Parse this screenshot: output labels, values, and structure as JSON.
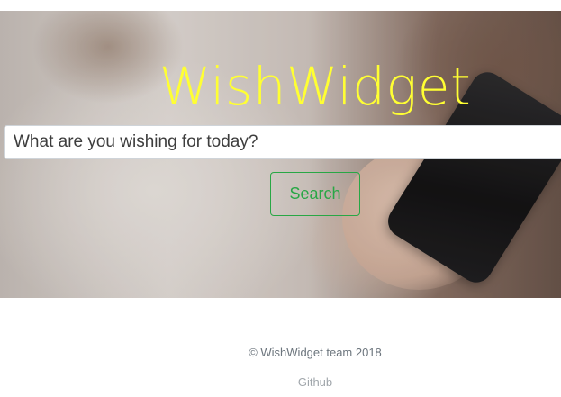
{
  "hero": {
    "title": "WishWidget",
    "title_color": "#ffff33"
  },
  "search": {
    "placeholder": "What are you wishing for today?",
    "button_label": "Search",
    "button_color": "#28a745"
  },
  "footer": {
    "copyright": "© WishWidget team 2018",
    "github_label": "Github"
  }
}
